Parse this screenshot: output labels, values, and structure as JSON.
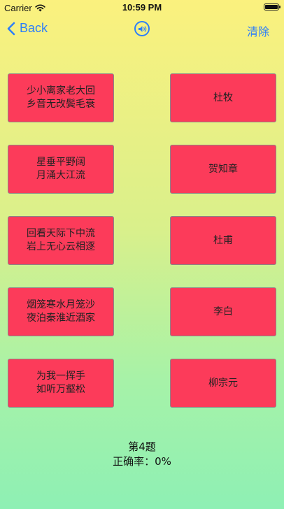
{
  "status_bar": {
    "carrier": "Carrier",
    "time": "10:59 PM"
  },
  "nav": {
    "back_label": "Back",
    "clear_label": "清除",
    "accent_color": "#2d7ff9"
  },
  "poems": [
    {
      "line1": "少小离家老大回",
      "line2": "乡音无改鬓毛衰"
    },
    {
      "line1": "星垂平野阔",
      "line2": "月涌大江流"
    },
    {
      "line1": "回看天际下中流",
      "line2": "岩上无心云相逐"
    },
    {
      "line1": "烟笼寒水月笼沙",
      "line2": "夜泊秦淮近酒家"
    },
    {
      "line1": "为我一挥手",
      "line2": "如听万壑松"
    }
  ],
  "authors": [
    "杜牧",
    "贺知章",
    "杜甫",
    "李白",
    "柳宗元"
  ],
  "footer": {
    "question": "第4题",
    "accuracy": "正确率：0%"
  },
  "colors": {
    "card_fill": "#fc3b5a",
    "card_border": "#888888"
  }
}
